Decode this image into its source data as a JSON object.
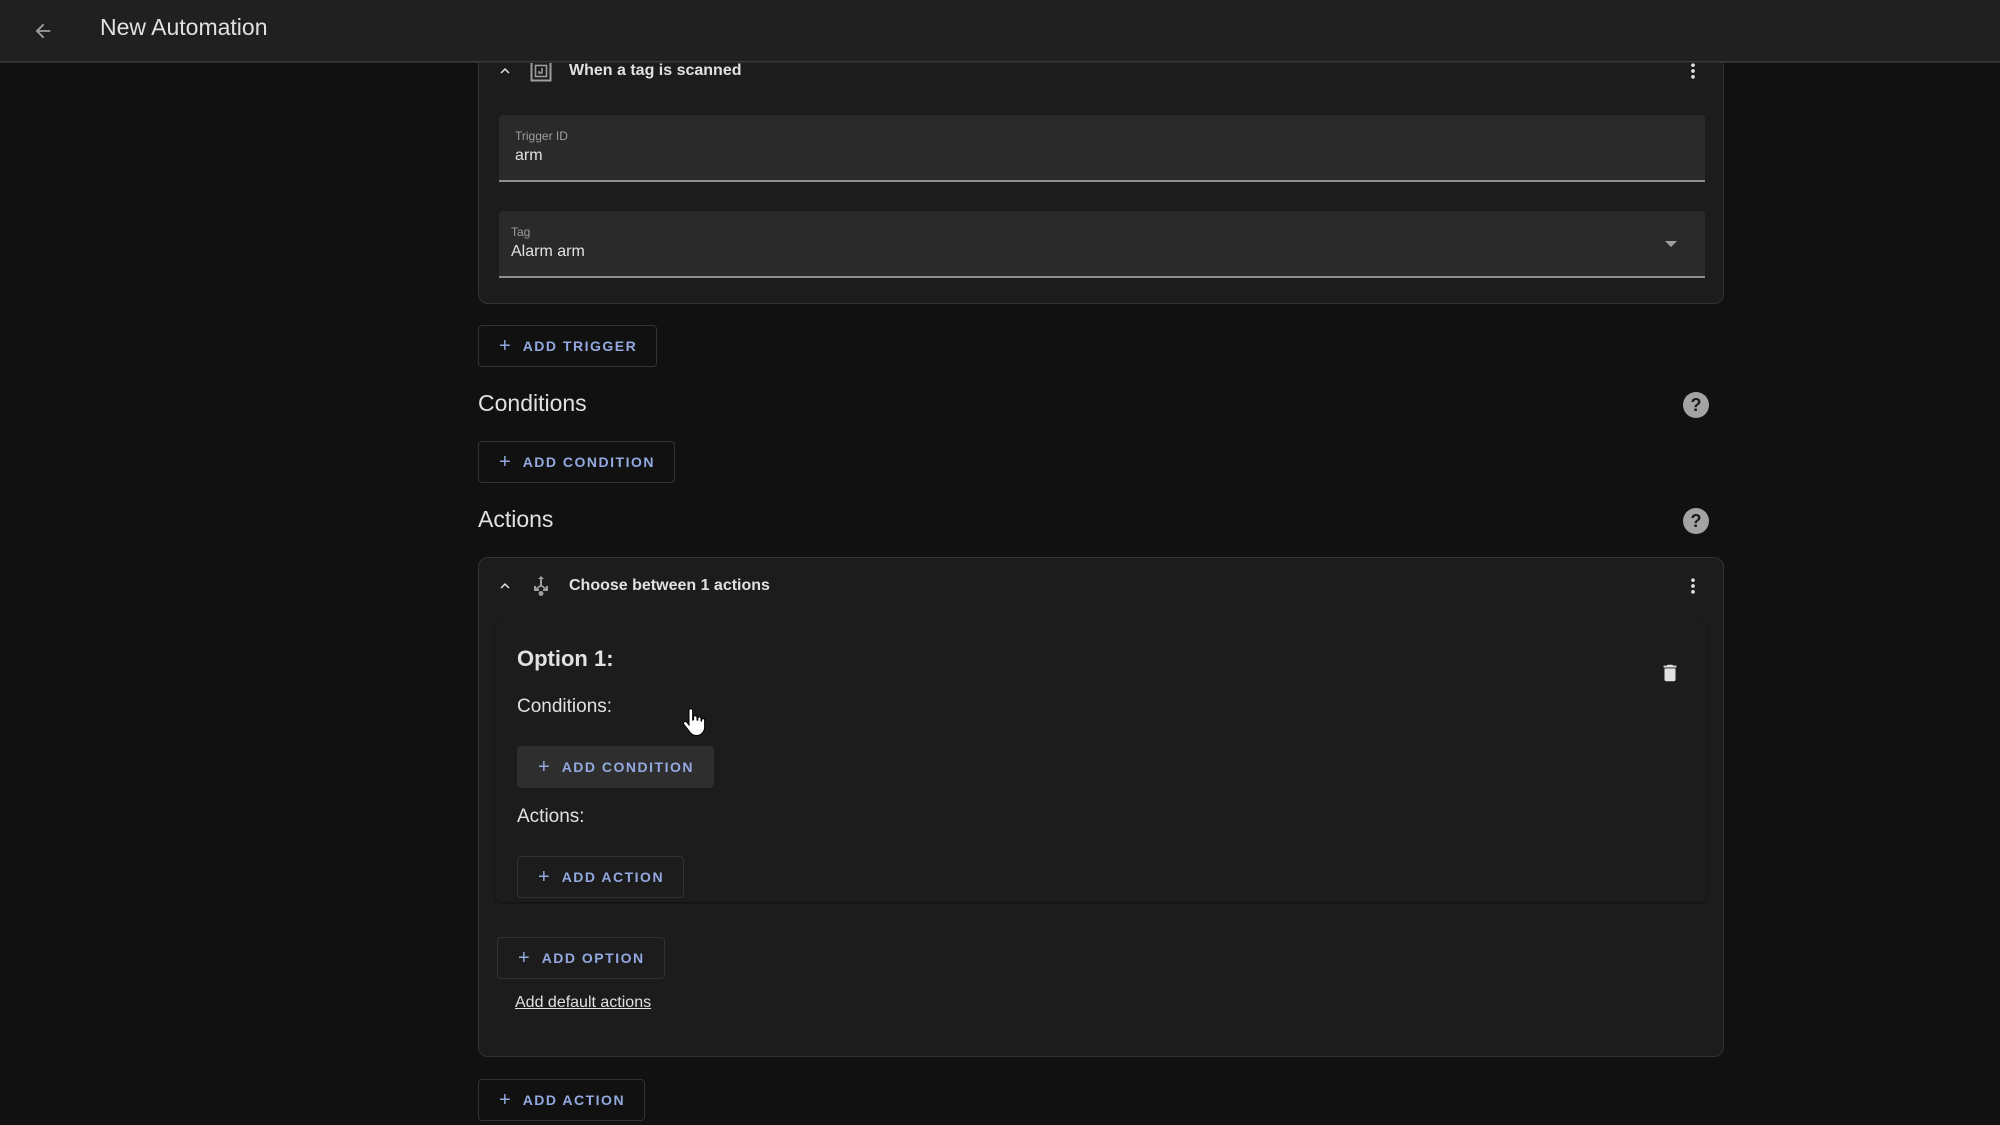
{
  "header": {
    "title": "New Automation",
    "back_icon": "arrow-left-icon"
  },
  "trigger": {
    "title": "When a tag is scanned",
    "icon": "nfc-tag-icon",
    "fields": {
      "trigger_id": {
        "label": "Trigger ID",
        "value": "arm"
      },
      "tag": {
        "label": "Tag",
        "value": "Alarm arm"
      }
    },
    "add_trigger_label": "ADD TRIGGER"
  },
  "conditions": {
    "title": "Conditions",
    "add_condition_label": "ADD CONDITION"
  },
  "actions": {
    "title": "Actions",
    "choose_card": {
      "title": "Choose between 1 actions",
      "icon": "source-branch-icon",
      "option": {
        "title": "Option 1:",
        "conditions_label": "Conditions:",
        "add_condition_label": "ADD CONDITION",
        "actions_label": "Actions:",
        "add_action_label": "ADD ACTION"
      },
      "add_option_label": "ADD OPTION",
      "add_default_link": "Add default actions"
    },
    "add_action_label": "ADD ACTION"
  },
  "plus_glyph": "+",
  "help_glyph": "?",
  "colors": {
    "accent": "#93a9e0",
    "background": "#111111",
    "card": "#1c1c1c",
    "header": "#202020"
  }
}
